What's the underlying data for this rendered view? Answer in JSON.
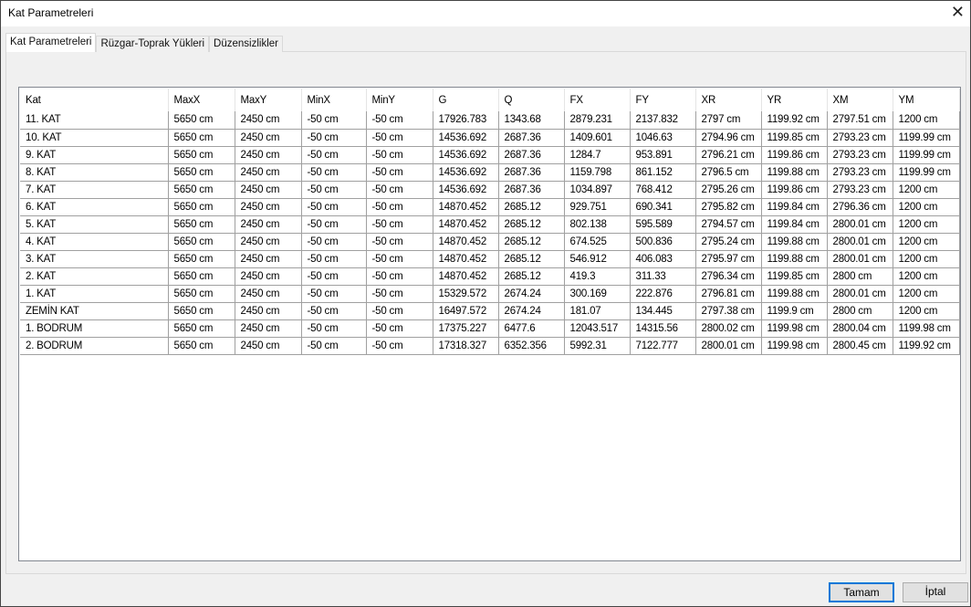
{
  "window": {
    "title": "Kat Parametreleri",
    "close_icon": "close-icon"
  },
  "tabs": [
    {
      "label": "Kat Parametreleri",
      "active": true
    },
    {
      "label": "Rüzgar-Toprak Yükleri"
    },
    {
      "label": "Düzensizlikler"
    }
  ],
  "table": {
    "columns": [
      "Kat",
      "MaxX",
      "MaxY",
      "MinX",
      "MinY",
      "G",
      "Q",
      "FX",
      "FY",
      "XR",
      "YR",
      "XM",
      "YM"
    ],
    "rows": [
      [
        "11. KAT",
        "5650 cm",
        "2450 cm",
        "-50 cm",
        "-50 cm",
        "17926.783",
        "1343.68",
        "2879.231",
        "2137.832",
        "2797 cm",
        "1199.92 cm",
        "2797.51 cm",
        "1200 cm"
      ],
      [
        "10. KAT",
        "5650 cm",
        "2450 cm",
        "-50 cm",
        "-50 cm",
        "14536.692",
        "2687.36",
        "1409.601",
        "1046.63",
        "2794.96 cm",
        "1199.85 cm",
        "2793.23 cm",
        "1199.99 cm"
      ],
      [
        "9. KAT",
        "5650 cm",
        "2450 cm",
        "-50 cm",
        "-50 cm",
        "14536.692",
        "2687.36",
        "1284.7",
        "953.891",
        "2796.21 cm",
        "1199.86 cm",
        "2793.23 cm",
        "1199.99 cm"
      ],
      [
        "8. KAT",
        "5650 cm",
        "2450 cm",
        "-50 cm",
        "-50 cm",
        "14536.692",
        "2687.36",
        "1159.798",
        "861.152",
        "2796.5 cm",
        "1199.88 cm",
        "2793.23 cm",
        "1199.99 cm"
      ],
      [
        "7. KAT",
        "5650 cm",
        "2450 cm",
        "-50 cm",
        "-50 cm",
        "14536.692",
        "2687.36",
        "1034.897",
        "768.412",
        "2795.26 cm",
        "1199.86 cm",
        "2793.23 cm",
        "1200 cm"
      ],
      [
        "6. KAT",
        "5650 cm",
        "2450 cm",
        "-50 cm",
        "-50 cm",
        "14870.452",
        "2685.12",
        "929.751",
        "690.341",
        "2795.82 cm",
        "1199.84 cm",
        "2796.36 cm",
        "1200 cm"
      ],
      [
        "5. KAT",
        "5650 cm",
        "2450 cm",
        "-50 cm",
        "-50 cm",
        "14870.452",
        "2685.12",
        "802.138",
        "595.589",
        "2794.57 cm",
        "1199.84 cm",
        "2800.01 cm",
        "1200 cm"
      ],
      [
        "4. KAT",
        "5650 cm",
        "2450 cm",
        "-50 cm",
        "-50 cm",
        "14870.452",
        "2685.12",
        "674.525",
        "500.836",
        "2795.24 cm",
        "1199.88 cm",
        "2800.01 cm",
        "1200 cm"
      ],
      [
        "3. KAT",
        "5650 cm",
        "2450 cm",
        "-50 cm",
        "-50 cm",
        "14870.452",
        "2685.12",
        "546.912",
        "406.083",
        "2795.97 cm",
        "1199.88 cm",
        "2800.01 cm",
        "1200 cm"
      ],
      [
        "2. KAT",
        "5650 cm",
        "2450 cm",
        "-50 cm",
        "-50 cm",
        "14870.452",
        "2685.12",
        "419.3",
        "311.33",
        "2796.34 cm",
        "1199.85 cm",
        "2800 cm",
        "1200 cm"
      ],
      [
        "1. KAT",
        "5650 cm",
        "2450 cm",
        "-50 cm",
        "-50 cm",
        "15329.572",
        "2674.24",
        "300.169",
        "222.876",
        "2796.81 cm",
        "1199.88 cm",
        "2800.01 cm",
        "1200 cm"
      ],
      [
        "ZEMİN KAT",
        "5650 cm",
        "2450 cm",
        "-50 cm",
        "-50 cm",
        "16497.572",
        "2674.24",
        "181.07",
        "134.445",
        "2797.38 cm",
        "1199.9 cm",
        "2800 cm",
        "1200 cm"
      ],
      [
        "1. BODRUM",
        "5650 cm",
        "2450 cm",
        "-50 cm",
        "-50 cm",
        "17375.227",
        "6477.6",
        "12043.517",
        "14315.56",
        "2800.02 cm",
        "1199.98 cm",
        "2800.04 cm",
        "1199.98 cm"
      ],
      [
        "2. BODRUM",
        "5650 cm",
        "2450 cm",
        "-50 cm",
        "-50 cm",
        "17318.327",
        "6352.356",
        "5992.31",
        "7122.777",
        "2800.01 cm",
        "1199.98 cm",
        "2800.45 cm",
        "1199.92 cm"
      ]
    ]
  },
  "buttons": {
    "ok": "Tamam",
    "cancel": "İptal"
  },
  "colors": {
    "accent": "#0078d7"
  }
}
